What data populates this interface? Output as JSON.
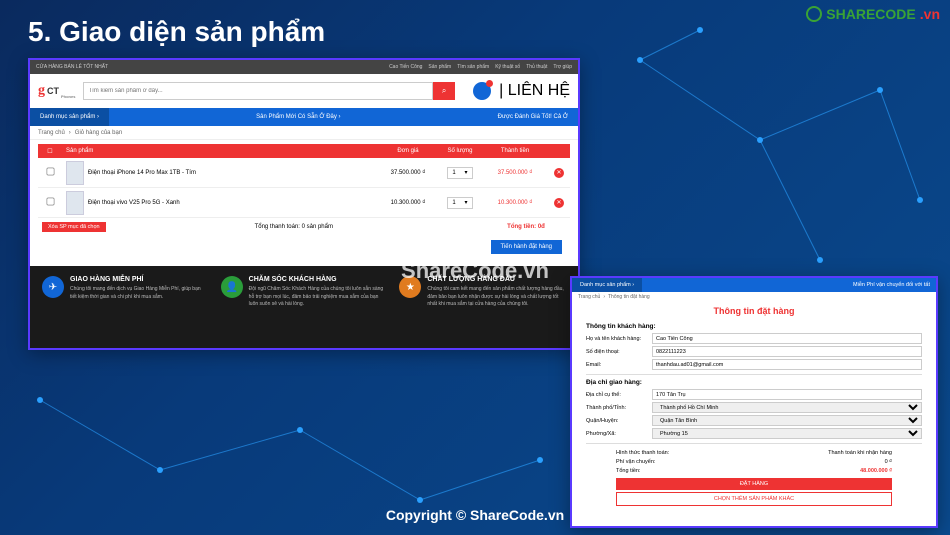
{
  "slide_title": "5. Giao diện sản phẩm",
  "watermark_logo": {
    "text": "SHARECODE",
    "suffix": ".vn"
  },
  "watermark_center": "ShareCode.vn",
  "watermark_bottom": "Copyright © ShareCode.vn",
  "card1": {
    "topbar_left": "CỬA HÀNG BÁN LẺ TỐT NHẤT",
    "topbar_items": [
      "Cao Tiến Công",
      "Sản phẩm",
      "Tìm sản phẩm",
      "Kỹ thuật số",
      "Thủ thuật",
      "Trợ giúp"
    ],
    "logo_sub": "Phones",
    "search_placeholder": "Tìm kiếm sản phẩm ở đây...",
    "contact": "| LIÊN HỆ",
    "nav_cat": "Danh mục sản phẩm ›",
    "nav_mid": "Sản Phẩm Mới Có Sẵn Ở Đây ›",
    "nav_right": "Được Đánh Giá Tốt! Cả Ở",
    "breadcrumb": [
      "Trang chủ",
      "›",
      "Giỏ hàng của bạn"
    ],
    "thead": {
      "chk": "☐",
      "prod": "Sản phẩm",
      "price": "Đơn giá",
      "qty": "Số lượng",
      "sub": "Thành tiền"
    },
    "rows": [
      {
        "name": "Điện thoại iPhone 14 Pro Max 1TB - Tím",
        "price": "37.500.000 ₫",
        "qty": "1",
        "sub": "37.500.000 ₫"
      },
      {
        "name": "Điện thoại vivo V25 Pro 5G - Xanh",
        "price": "10.300.000 ₫",
        "qty": "1",
        "sub": "10.300.000 ₫"
      }
    ],
    "btn_del_selected": "Xóa SP mục đã chọn",
    "total_label": "Tổng thanh toán: 0 sản phẩm",
    "total_value": "Tổng tiền: 0đ",
    "btn_order": "Tiến hành đặt hàng",
    "features": [
      {
        "icon": "✈",
        "title": "GIAO HÀNG MIỄN PHÍ",
        "desc": "Chúng tôi mang đến dịch vụ Giao Hàng Miễn Phí, giúp bạn tiết kiệm thời gian và chi phí khi mua sắm."
      },
      {
        "icon": "👤",
        "title": "CHĂM SÓC KHÁCH HÀNG",
        "desc": "Đội ngũ Chăm Sóc Khách Hàng của chúng tôi luôn sẵn sàng hỗ trợ bạn mọi lúc, đảm bảo trải nghiệm mua sắm của bạn luôn suôn sẻ và hài lòng."
      },
      {
        "icon": "★",
        "title": "CHẤT LƯỢNG HÀNG ĐẦU",
        "desc": "Chúng tôi cam kết mang đến sản phẩm chất lượng hàng đầu, đảm bảo bạn luôn nhận được sự hài lòng và chất lượng tốt nhất khi mua sắm tại cửa hàng của chúng tôi."
      }
    ]
  },
  "card2": {
    "nav_cat": "Danh mục sản phẩm ›",
    "nav_right": "Miễn Phí vận chuyển đối với tất",
    "breadcrumb": [
      "Trang chủ",
      "›",
      "Thông tin đặt hàng"
    ],
    "title": "Thông tin đặt hàng",
    "sec1": "Thông tin khách hàng:",
    "fields1": [
      {
        "label": "Họ và tên khách hàng:",
        "value": "Cao Tiến Công"
      },
      {
        "label": "Số điện thoại:",
        "value": "0822111223"
      },
      {
        "label": "Email:",
        "value": "thanhdau.ad01@gmail.com"
      }
    ],
    "sec2": "Địa chỉ giao hàng:",
    "fields2": [
      {
        "label": "Địa chỉ cụ thể:",
        "value": "170 Tân Trụ",
        "type": "input"
      },
      {
        "label": "Thành phố/Tỉnh:",
        "value": "Thành phố Hồ Chí Minh",
        "type": "select"
      },
      {
        "label": "Quận/Huyện:",
        "value": "Quận Tân Bình",
        "type": "select"
      },
      {
        "label": "Phường/Xã:",
        "value": "Phường 15",
        "type": "select"
      }
    ],
    "summary": [
      {
        "label": "Hình thức thanh toán:",
        "value": "Thanh toán khi nhận hàng"
      },
      {
        "label": "Phí vận chuyển:",
        "value": "0 ₫"
      },
      {
        "label": "Tổng tiền:",
        "value": "48.000.000 ₫",
        "red": true
      }
    ],
    "btn_primary": "ĐẶT HÀNG",
    "btn_secondary": "CHỌN THÊM SẢN PHẨM KHÁC"
  }
}
